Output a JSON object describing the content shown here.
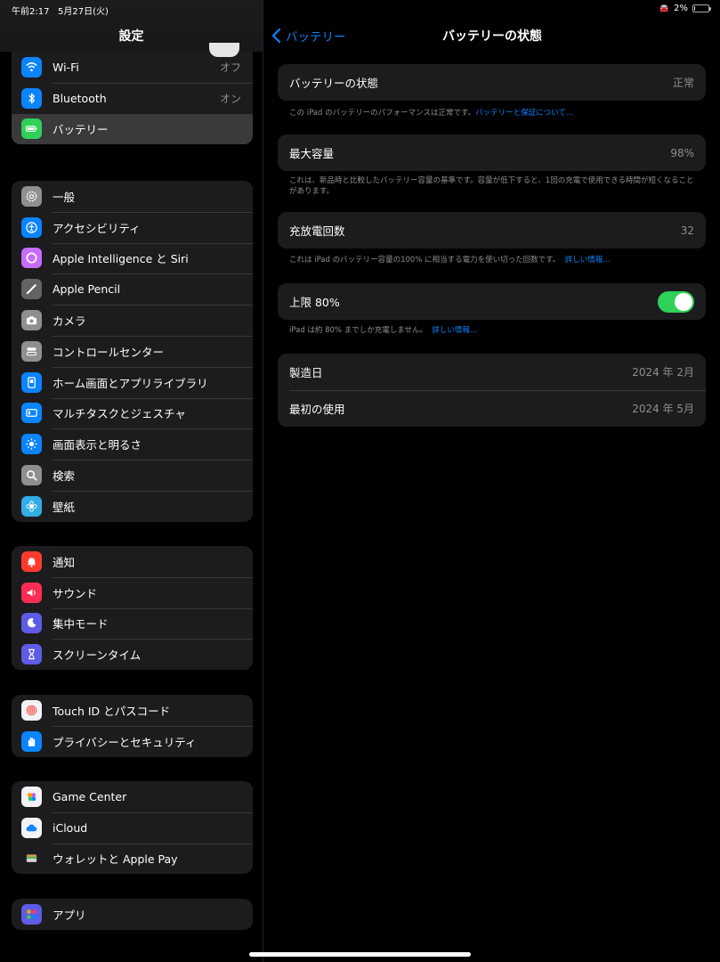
{
  "status_bar": {
    "time": "午前2:17",
    "date": "5月27日(火)",
    "battery_percent": "2%",
    "battery_level": 0.02
  },
  "sidebar": {
    "title": "設定",
    "group1": [
      {
        "label": "Wi-Fi",
        "value": "オフ",
        "icon": "wifi-icon",
        "color": "#0a84ff"
      },
      {
        "label": "Bluetooth",
        "value": "オン",
        "icon": "bluetooth-icon",
        "color": "#0a84ff"
      },
      {
        "label": "バッテリー",
        "value": "",
        "icon": "battery-icon",
        "color": "#30d158",
        "selected": true
      }
    ],
    "group2": [
      {
        "label": "一般",
        "icon": "gear-icon",
        "color": "#8e8e93"
      },
      {
        "label": "アクセシビリティ",
        "icon": "accessibility-icon",
        "color": "#0a84ff"
      },
      {
        "label": "Apple Intelligence と Siri",
        "icon": "apple-intelligence-icon",
        "color": "#c86bff"
      },
      {
        "label": "Apple Pencil",
        "icon": "pencil-icon",
        "color": "#636366"
      },
      {
        "label": "カメラ",
        "icon": "camera-icon",
        "color": "#8e8e93"
      },
      {
        "label": "コントロールセンター",
        "icon": "control-center-icon",
        "color": "#8e8e93"
      },
      {
        "label": "ホーム画面とアプリライブラリ",
        "icon": "home-screen-icon",
        "color": "#0a84ff"
      },
      {
        "label": "マルチタスクとジェスチャ",
        "icon": "multitasking-icon",
        "color": "#0a84ff"
      },
      {
        "label": "画面表示と明るさ",
        "icon": "brightness-icon",
        "color": "#0a84ff"
      },
      {
        "label": "検索",
        "icon": "search-icon",
        "color": "#8e8e93"
      },
      {
        "label": "壁紙",
        "icon": "wallpaper-icon",
        "color": "#32ade6"
      }
    ],
    "group3": [
      {
        "label": "通知",
        "icon": "notification-icon",
        "color": "#ff3b30"
      },
      {
        "label": "サウンド",
        "icon": "sound-icon",
        "color": "#ff2d55"
      },
      {
        "label": "集中モード",
        "icon": "focus-moon-icon",
        "color": "#5e5ce6"
      },
      {
        "label": "スクリーンタイム",
        "icon": "hourglass-icon",
        "color": "#5e5ce6"
      }
    ],
    "group4": [
      {
        "label": "Touch ID とパスコード",
        "icon": "fingerprint-icon",
        "color": "#f2f2f7"
      },
      {
        "label": "プライバシーとセキュリティ",
        "icon": "hand-icon",
        "color": "#0a84ff"
      }
    ],
    "group5": [
      {
        "label": "Game Center",
        "icon": "game-center-icon",
        "color": "#f2f2f7"
      },
      {
        "label": "iCloud",
        "icon": "icloud-icon",
        "color": "#f2f2f7"
      },
      {
        "label": "ウォレットと Apple Pay",
        "icon": "wallet-icon",
        "color": "#1c1c1e"
      }
    ],
    "group6": [
      {
        "label": "アプリ",
        "icon": "apps-grid-icon",
        "color": "#5e5ce6"
      }
    ]
  },
  "detail": {
    "back_label": "バッテリー",
    "title": "バッテリーの状態",
    "health": {
      "label": "バッテリーの状態",
      "value": "正常",
      "footer": "この iPad のバッテリーのパフォーマンスは正常です。",
      "footer_link": "バッテリーと保証について..."
    },
    "max_capacity": {
      "label": "最大容量",
      "value": "98%",
      "footer": "これは、新品時と比較したバッテリー容量の基準です。容量が低下すると、1回の充電で使用できる時間が短くなることがあります。"
    },
    "cycle_count": {
      "label": "充放電回数",
      "value": "32",
      "footer": "これは iPad のバッテリー容量の100% に相当する電力を使い切った回数です。",
      "footer_link": "詳しい情報..."
    },
    "limit": {
      "label": "上限 80%",
      "on": true,
      "footer": "iPad は約 80% までしか充電しません。",
      "footer_link": "詳しい情報..."
    },
    "manufacture": {
      "label": "製造日",
      "value": "2024 年 2月"
    },
    "first_use": {
      "label": "最初の使用",
      "value": "2024 年 5月"
    }
  }
}
